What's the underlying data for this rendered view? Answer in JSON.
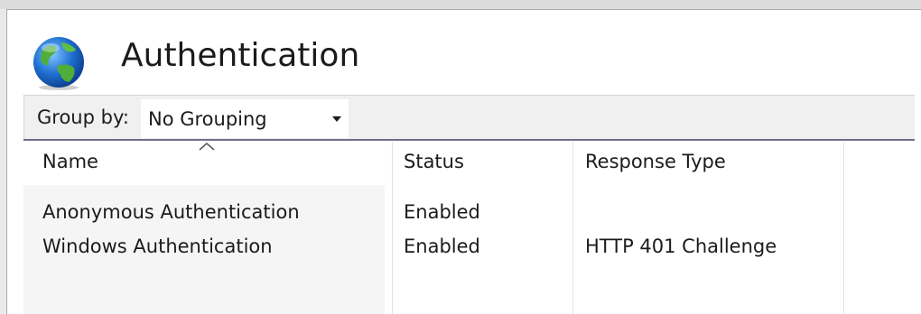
{
  "page": {
    "title": "Authentication"
  },
  "icons": {
    "page_icon": "globe-icon",
    "sort_indicator": "sort-ascending-icon",
    "dropdown": "chevron-down-icon"
  },
  "groupbar": {
    "label": "Group by:",
    "selected": "No Grouping"
  },
  "table": {
    "columns": [
      "Name",
      "Status",
      "Response Type"
    ],
    "rows": [
      {
        "name": "Anonymous Authentication",
        "status": "Enabled",
        "response_type": ""
      },
      {
        "name": "Windows Authentication",
        "status": "Enabled",
        "response_type": "HTTP 401 Challenge"
      }
    ]
  },
  "colors": {
    "globe_ocean": "#1f6fd1",
    "globe_land": "#4fae3a",
    "header_divider": "#6f6f8a"
  }
}
